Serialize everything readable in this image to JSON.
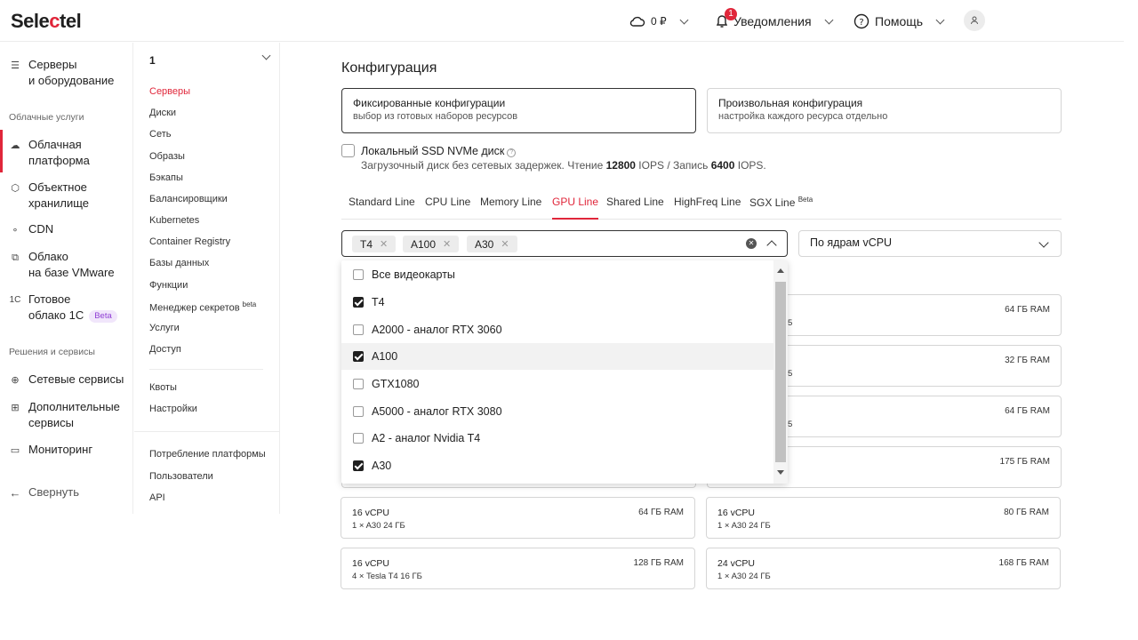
{
  "header": {
    "logo_part1": "Sele",
    "logo_accent": "c",
    "logo_part2": "tel",
    "balance": "0 ₽",
    "notifications_label": "Уведомления",
    "notifications_count": "1",
    "help_label": "Помощь"
  },
  "sidebar": {
    "servers": [
      "Серверы",
      "и оборудование"
    ],
    "group_cloud": "Облачные услуги",
    "cloud_platform": [
      "Облачная",
      "платформа"
    ],
    "object_storage": [
      "Объектное",
      "хранилище"
    ],
    "cdn": "CDN",
    "vmware": [
      "Облако",
      "на базе VMware"
    ],
    "onec": [
      "Готовое",
      "облако 1С"
    ],
    "onec_icon": "1С",
    "beta": "Beta",
    "group_solutions": "Решения и сервисы",
    "network_services": "Сетевые сервисы",
    "additional_services": [
      "Дополнительные",
      "сервисы"
    ],
    "monitoring": "Мониторинг",
    "collapse": "Свернуть"
  },
  "subnav": {
    "project": "1",
    "items": [
      "Серверы",
      "Диски",
      "Сеть",
      "Образы",
      "Бэкапы",
      "Балансировщики",
      "Kubernetes",
      "Container Registry",
      "Базы данных",
      "Функции",
      "Менеджер секретов",
      "Услуги",
      "Доступ"
    ],
    "secrets_sup": "beta",
    "items2": [
      "Квоты",
      "Настройки"
    ],
    "items3": [
      "Потребление платформы",
      "Пользователи",
      "API"
    ]
  },
  "main": {
    "title": "Конфигурация",
    "fixed_title": "Фиксированные конфигурации",
    "fixed_sub": "выбор из готовых наборов ресурсов",
    "custom_title": "Произвольная конфигурация",
    "custom_sub": "настройка каждого ресурса отдельно",
    "ssd_title": "Локальный SSD NVMe диск",
    "ssd_desc_1": "Загрузочный диск без сетевых задержек. Чтение ",
    "ssd_read": "12800",
    "ssd_desc_2": " IOPS / Запись ",
    "ssd_write": "6400",
    "ssd_desc_3": " IOPS.",
    "tabs": [
      "Standard Line",
      "CPU Line",
      "Memory Line",
      "GPU Line",
      "Shared Line",
      "HighFreq Line",
      "SGX Line"
    ],
    "tab_sup": "Beta",
    "chips": [
      "T4",
      "A100",
      "A30"
    ],
    "sort_label": "По ядрам vCPU"
  },
  "dropdown": {
    "items": [
      {
        "label": "Все видеокарты",
        "checked": false
      },
      {
        "label": "T4",
        "checked": true
      },
      {
        "label": "A2000 - аналог RTX 3060",
        "checked": false
      },
      {
        "label": "A100",
        "checked": true
      },
      {
        "label": "GTX1080",
        "checked": false
      },
      {
        "label": "A5000 - аналог RTX 3080",
        "checked": false
      },
      {
        "label": "A2 - аналог Nvidia T4",
        "checked": false
      },
      {
        "label": "A30",
        "checked": true
      }
    ]
  },
  "servers": {
    "partial": [
      {
        "ram": "64 ГБ RAM",
        "frag": "5"
      },
      {
        "ram": "32 ГБ RAM",
        "frag": "5"
      },
      {
        "ram": "64 ГБ RAM",
        "frag": "5"
      },
      {
        "ram": "175 ГБ RAM",
        "frag": ""
      }
    ],
    "rows": [
      {
        "cpu": "16 vCPU",
        "gpu": "1 × A30  24 ГБ",
        "ram": "64 ГБ RAM"
      },
      {
        "cpu": "16 vCPU",
        "gpu": "1 × A30  24 ГБ",
        "ram": "80 ГБ RAM"
      },
      {
        "cpu": "16 vCPU",
        "gpu": "4 × Tesla T4  16 ГБ",
        "ram": "128 ГБ RAM"
      },
      {
        "cpu": "24 vCPU",
        "gpu": "1 × A30  24 ГБ",
        "ram": "168 ГБ RAM"
      }
    ]
  }
}
